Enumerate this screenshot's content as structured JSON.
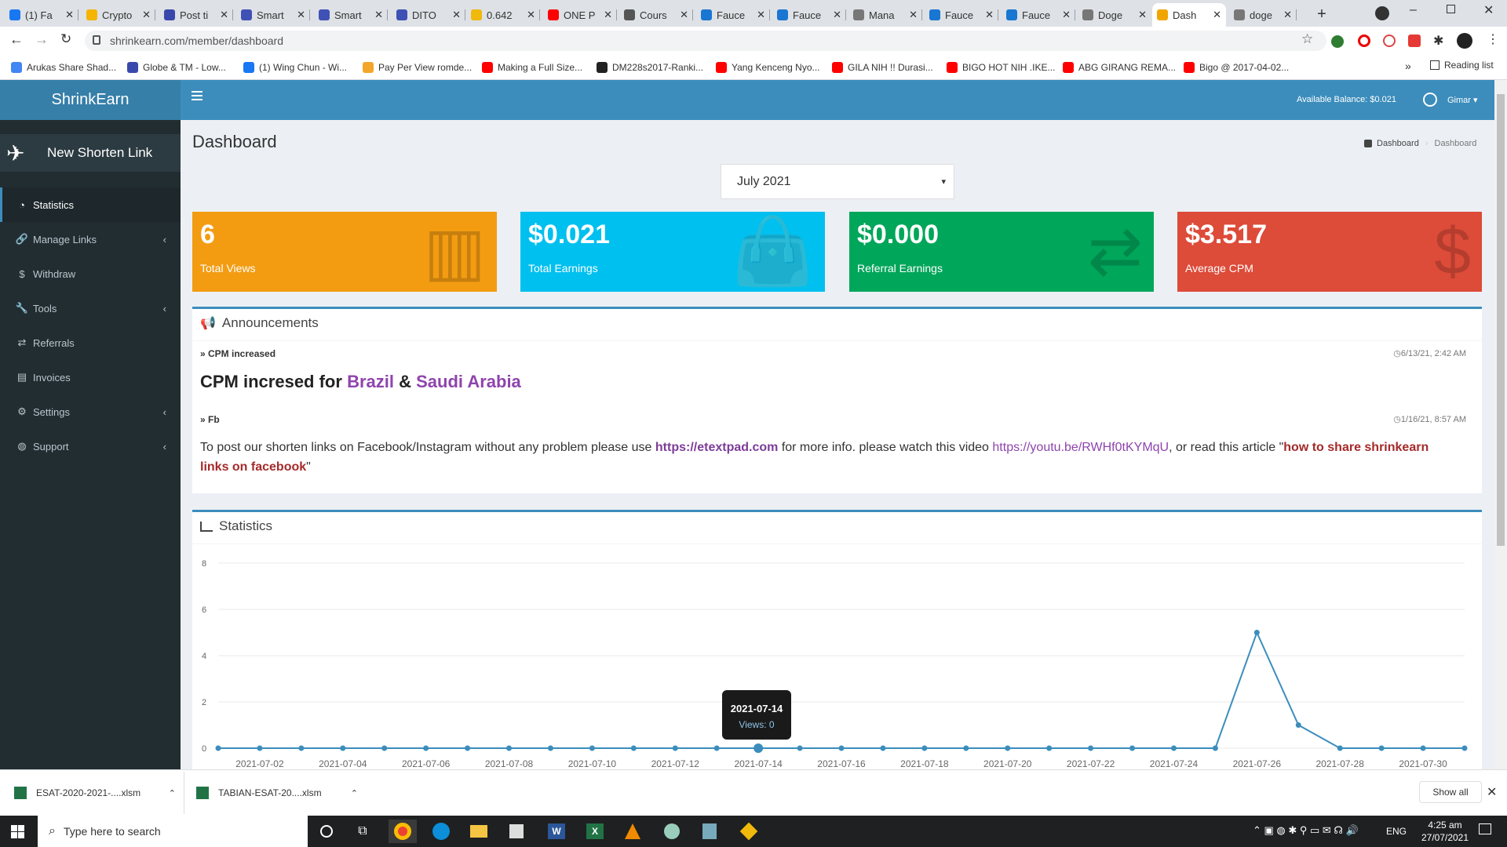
{
  "browser": {
    "tabs": [
      {
        "label": "(1) Fa",
        "color": "#1877f2"
      },
      {
        "label": "Crypto",
        "color": "#f4b400"
      },
      {
        "label": "Post ti",
        "color": "#3949ab"
      },
      {
        "label": "Smart",
        "color": "#3f51b5"
      },
      {
        "label": "Smart",
        "color": "#3f51b5"
      },
      {
        "label": "DITO",
        "color": "#3f51b5"
      },
      {
        "label": "0.642",
        "color": "#f0b90b"
      },
      {
        "label": "ONE P",
        "color": "#ff0000"
      },
      {
        "label": "Cours",
        "color": "#555555"
      },
      {
        "label": "Fauce",
        "color": "#1976d2"
      },
      {
        "label": "Fauce",
        "color": "#1976d2"
      },
      {
        "label": "Mana",
        "color": "#777777"
      },
      {
        "label": "Fauce",
        "color": "#1976d2"
      },
      {
        "label": "Fauce",
        "color": "#1976d2"
      },
      {
        "label": "Doge",
        "color": "#777777"
      },
      {
        "label": "Dash",
        "color": "#f1a500"
      },
      {
        "label": "doge",
        "color": "#777777"
      }
    ],
    "url": "shrinkearn.com/member/dashboard",
    "bookmarks": [
      "Arukas Share Shad...",
      "Globe & TM - Low...",
      "(1) Wing Chun - Wi...",
      "Pay Per View romde...",
      "Making a Full Size...",
      "DM228s2017-Ranki...",
      "Yang Kenceng Nyo...",
      "GILA NIH !! Durasi...",
      "BIGO HOT NIH .IKE...",
      "ABG GIRANG REMA...",
      "Bigo @ 2017-04-02..."
    ],
    "reading_list": "Reading list"
  },
  "app": {
    "logo": "ShrinkEarn",
    "balance": "Available Balance: $0.021",
    "user": "Gimar",
    "new_link": "New Shorten Link",
    "nav": [
      {
        "label": "Statistics",
        "icon": "dashboard-icon",
        "chev": false
      },
      {
        "label": "Manage Links",
        "icon": "link-icon",
        "chev": true
      },
      {
        "label": "Withdraw",
        "icon": "dollar-icon",
        "chev": false
      },
      {
        "label": "Tools",
        "icon": "wrench-icon",
        "chev": true
      },
      {
        "label": "Referrals",
        "icon": "exchange-icon",
        "chev": false
      },
      {
        "label": "Invoices",
        "icon": "invoice-icon",
        "chev": false
      },
      {
        "label": "Settings",
        "icon": "cogs-icon",
        "chev": true
      },
      {
        "label": "Support",
        "icon": "globe-icon",
        "chev": true
      }
    ],
    "page_title": "Dashboard",
    "breadcrumb": [
      "Dashboard",
      "Dashboard"
    ],
    "month": "July 2021",
    "stats": [
      {
        "value": "6",
        "label": "Total Views",
        "color": "#f39c12",
        "icon": "bar-chart-icon"
      },
      {
        "value": "$0.021",
        "label": "Total Earnings",
        "color": "#00c0ef",
        "icon": "shopping-bag-icon"
      },
      {
        "value": "$0.000",
        "label": "Referral Earnings",
        "color": "#00a65a",
        "icon": "exchange-icon"
      },
      {
        "value": "$3.517",
        "label": "Average CPM",
        "color": "#dd4b39",
        "icon": "dollar-icon"
      }
    ],
    "announcements": {
      "title": "Announcements",
      "items": [
        {
          "title": "CPM increased",
          "date": "6/13/21, 2:42 AM"
        },
        {
          "title": "Fb",
          "date": "1/16/21, 8:57 AM"
        }
      ],
      "cpm_text": "CPM incresed for",
      "brazil": "Brazil",
      "amp": "&",
      "saudi": "Saudi Arabia",
      "fb_text1": "To post our shorten links on Facebook/Instagram without any problem please use",
      "fb_link1": "https://etextpad.com",
      "fb_text2": "for more info. please watch this video",
      "fb_link2": "https://youtu.be/RWHf0tKYMqU",
      "fb_text3": ", or read this article \"",
      "fb_link3": "how to share shrinkearn links on facebook",
      "fb_text4": "\""
    },
    "statistics_title": "Statistics"
  },
  "chart_data": {
    "type": "line",
    "x": [
      "2021-07-01",
      "2021-07-02",
      "2021-07-03",
      "2021-07-04",
      "2021-07-05",
      "2021-07-06",
      "2021-07-07",
      "2021-07-08",
      "2021-07-09",
      "2021-07-10",
      "2021-07-11",
      "2021-07-12",
      "2021-07-13",
      "2021-07-14",
      "2021-07-15",
      "2021-07-16",
      "2021-07-17",
      "2021-07-18",
      "2021-07-19",
      "2021-07-20",
      "2021-07-21",
      "2021-07-22",
      "2021-07-23",
      "2021-07-24",
      "2021-07-25",
      "2021-07-26",
      "2021-07-27",
      "2021-07-28",
      "2021-07-29",
      "2021-07-30",
      "2021-07-31"
    ],
    "series": [
      {
        "name": "Views",
        "values": [
          0,
          0,
          0,
          0,
          0,
          0,
          0,
          0,
          0,
          0,
          0,
          0,
          0,
          0,
          0,
          0,
          0,
          0,
          0,
          0,
          0,
          0,
          0,
          0,
          0,
          5,
          1,
          0,
          0,
          0,
          0
        ]
      }
    ],
    "xticks": [
      "2021-07-02",
      "2021-07-04",
      "2021-07-06",
      "2021-07-08",
      "2021-07-10",
      "2021-07-12",
      "2021-07-14",
      "2021-07-16",
      "2021-07-18",
      "2021-07-20",
      "2021-07-22",
      "2021-07-24",
      "2021-07-26",
      "2021-07-28",
      "2021-07-30"
    ],
    "yticks": [
      0,
      2,
      4,
      6,
      8
    ],
    "ylim": [
      0,
      8
    ],
    "color": "#3c8dbc",
    "tooltip": {
      "date": "2021-07-14",
      "text": "Views: 0"
    }
  },
  "downloads": [
    {
      "name": "ESAT-2020-2021-....xlsm"
    },
    {
      "name": "TABIAN-ESAT-20....xlsm"
    }
  ],
  "show_all": "Show all",
  "taskbar": {
    "search": "Type here to search",
    "lang": "ENG",
    "time": "4:25 am",
    "date": "27/07/2021"
  }
}
